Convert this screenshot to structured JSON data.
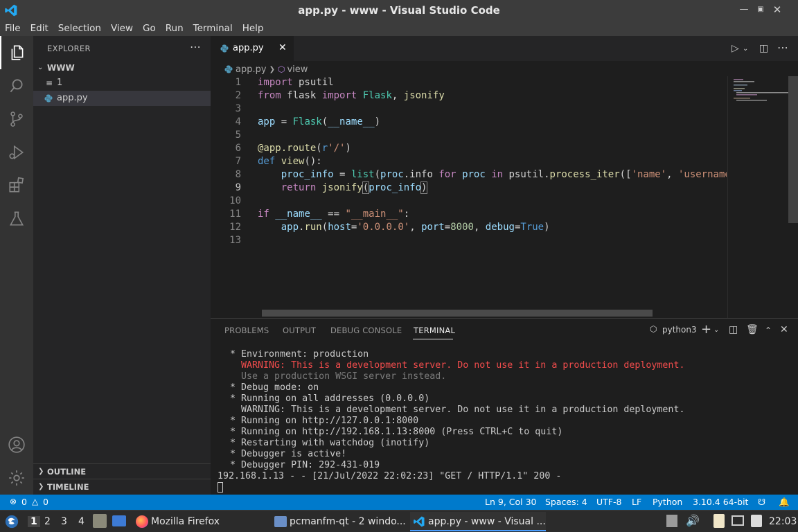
{
  "window": {
    "title": "app.py - www - Visual Studio Code"
  },
  "menu": [
    "File",
    "Edit",
    "Selection",
    "View",
    "Go",
    "Run",
    "Terminal",
    "Help"
  ],
  "explorer": {
    "header": "EXPLORER",
    "folder": "WWW",
    "items": [
      {
        "name": "1",
        "icon": "text-file-icon"
      },
      {
        "name": "app.py",
        "icon": "python-file-icon"
      }
    ],
    "outline": "OUTLINE",
    "timeline": "TIMELINE"
  },
  "editor": {
    "tab": "app.py",
    "breadcrumb": {
      "file": "app.py",
      "symbol": "view"
    },
    "current_line": 9,
    "lines": [
      "1",
      "2",
      "3",
      "4",
      "5",
      "6",
      "7",
      "8",
      "9",
      "10",
      "11",
      "12",
      "13"
    ]
  },
  "panel": {
    "tabs": [
      "PROBLEMS",
      "OUTPUT",
      "DEBUG CONSOLE",
      "TERMINAL"
    ],
    "active_tab": "TERMINAL",
    "shell": "python3",
    "terminal_lines": [
      " * Environment: production",
      "   WARNING: This is a development server. Do not use it in a production deployment.",
      "   Use a production WSGI server instead.",
      " * Debug mode: on",
      " * Running on all addresses (0.0.0.0)",
      "   WARNING: This is a development server. Do not use it in a production deployment.",
      " * Running on http://127.0.0.1:8000",
      " * Running on http://192.168.1.13:8000 (Press CTRL+C to quit)",
      " * Restarting with watchdog (inotify)",
      " * Debugger is active!",
      " * Debugger PIN: 292-431-019",
      "192.168.1.13 - - [21/Jul/2022 22:02:23] \"GET / HTTP/1.1\" 200 -"
    ]
  },
  "statusbar": {
    "errors": "0",
    "warnings": "0",
    "position": "Ln 9, Col 30",
    "spaces": "Spaces: 4",
    "encoding": "UTF-8",
    "eol": "LF",
    "language": "Python",
    "interpreter": "3.10.4 64-bit"
  },
  "taskbar": {
    "workspaces": [
      "1",
      "2",
      "3",
      "4"
    ],
    "tasks": [
      {
        "label": "Mozilla Firefox",
        "icon": "firefox-icon"
      },
      {
        "label": "pcmanfm-qt - 2 windo...",
        "icon": "folder-icon"
      },
      {
        "label": "app.py - www - Visual ...",
        "icon": "vscode-icon"
      }
    ],
    "clock": "22:03"
  },
  "colors": {
    "accent": "#007acc",
    "titlebar": "#3c3c3c",
    "editor_bg": "#1e1e1e",
    "sidebar_bg": "#252526",
    "warning": "#f14c4c"
  }
}
